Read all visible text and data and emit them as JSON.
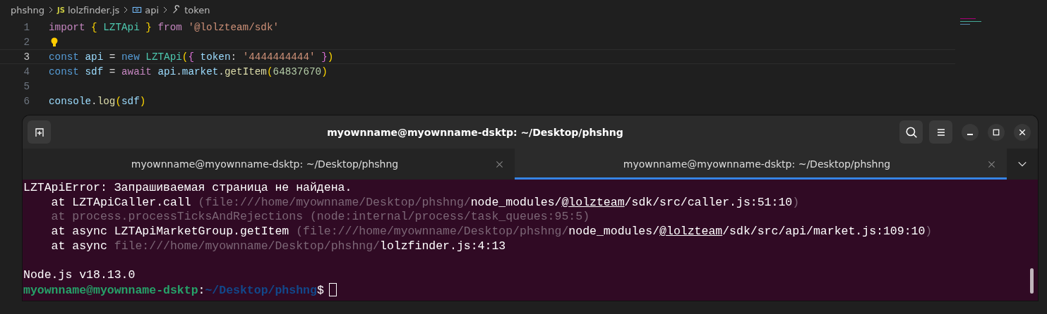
{
  "breadcrumbs": [
    {
      "kind": "folder",
      "label": "phshng"
    },
    {
      "kind": "file",
      "badge": "JS",
      "label": "lolzfinder.js"
    },
    {
      "kind": "variable",
      "label": "api"
    },
    {
      "kind": "property",
      "label": "token"
    }
  ],
  "editor": {
    "lines": [
      {
        "number": "1",
        "current": false,
        "tokens": [
          {
            "kind": "keyword",
            "text": "import "
          },
          {
            "kind": "brace",
            "text": "{ "
          },
          {
            "kind": "type",
            "text": "LZTApi "
          },
          {
            "kind": "brace",
            "text": "} "
          },
          {
            "kind": "keyword",
            "text": "from "
          },
          {
            "kind": "string",
            "text": "'@lolzteam/sdk'"
          }
        ]
      },
      {
        "number": "2",
        "current": false,
        "lightbulb": true
      },
      {
        "number": "3",
        "current": true,
        "tokens": [
          {
            "kind": "storage",
            "text": "const "
          },
          {
            "kind": "variable",
            "text": "api "
          },
          {
            "kind": "plain",
            "text": "= "
          },
          {
            "kind": "storage",
            "text": "new "
          },
          {
            "kind": "type",
            "text": "LZTApi"
          },
          {
            "kind": "brace",
            "text": "("
          },
          {
            "kind": "paren",
            "text": "{ "
          },
          {
            "kind": "variable",
            "text": "token"
          },
          {
            "kind": "plain",
            "text": ": "
          },
          {
            "kind": "string",
            "text": "'4444444444' "
          },
          {
            "kind": "paren",
            "text": "}"
          },
          {
            "kind": "brace",
            "text": ")"
          }
        ]
      },
      {
        "number": "4",
        "current": false,
        "tokens": [
          {
            "kind": "storage",
            "text": "const "
          },
          {
            "kind": "variable",
            "text": "sdf "
          },
          {
            "kind": "plain",
            "text": "= "
          },
          {
            "kind": "keyword",
            "text": "await "
          },
          {
            "kind": "variable",
            "text": "api"
          },
          {
            "kind": "plain",
            "text": "."
          },
          {
            "kind": "variable",
            "text": "market"
          },
          {
            "kind": "plain",
            "text": "."
          },
          {
            "kind": "function",
            "text": "getItem"
          },
          {
            "kind": "brace",
            "text": "("
          },
          {
            "kind": "number",
            "text": "64837670"
          },
          {
            "kind": "brace",
            "text": ")"
          }
        ]
      },
      {
        "number": "5",
        "current": false
      },
      {
        "number": "6",
        "current": false,
        "tokens": [
          {
            "kind": "variable",
            "text": "console"
          },
          {
            "kind": "plain",
            "text": "."
          },
          {
            "kind": "function",
            "text": "log"
          },
          {
            "kind": "brace",
            "text": "("
          },
          {
            "kind": "variable",
            "text": "sdf"
          },
          {
            "kind": "brace",
            "text": ")"
          }
        ]
      }
    ]
  },
  "terminal": {
    "title": "myownname@myownname-dsktp: ~/Desktop/phshng",
    "tabs": [
      {
        "label": "myownname@myownname-dsktp: ~/Desktop/phshng",
        "selected": false
      },
      {
        "label": "myownname@myownname-dsktp: ~/Desktop/phshng",
        "selected": true
      }
    ],
    "output": [
      [
        {
          "kind": "plain",
          "text": "LZTApiError: Запрашиваемая страница не найдена."
        }
      ],
      [
        {
          "kind": "plain",
          "text": "    at LZTApiCaller.call "
        },
        {
          "kind": "dim",
          "text": "(file:///home/myownname/Desktop/phshng/"
        },
        {
          "kind": "plain",
          "text": "node_modules/"
        },
        {
          "kind": "link",
          "text": "@lolzteam"
        },
        {
          "kind": "plain",
          "text": "/sdk/src/caller.js:51:10"
        },
        {
          "kind": "dim",
          "text": ")"
        }
      ],
      [
        {
          "kind": "dim",
          "text": "    at process.processTicksAndRejections (node:internal/process/task_queues:95:5)"
        }
      ],
      [
        {
          "kind": "plain",
          "text": "    at async LZTApiMarketGroup.getItem "
        },
        {
          "kind": "dim",
          "text": "(file:///home/myownname/Desktop/phshng/"
        },
        {
          "kind": "plain",
          "text": "node_modules/"
        },
        {
          "kind": "link",
          "text": "@lolzteam"
        },
        {
          "kind": "plain",
          "text": "/sdk/src/api/market.js:109:10"
        },
        {
          "kind": "dim",
          "text": ")"
        }
      ],
      [
        {
          "kind": "plain",
          "text": "    at async "
        },
        {
          "kind": "dim",
          "text": "file:///home/myownname/Desktop/phshng/"
        },
        {
          "kind": "plain",
          "text": "lolzfinder.js:4:13"
        }
      ],
      [
        {
          "kind": "gap"
        },
        {
          "kind": "plain",
          "text": "Node.js v18.13.0"
        }
      ]
    ],
    "prompt": {
      "user": "myownname@myownname-dsktp",
      "separator": ":",
      "path": "~/Desktop/phshng",
      "symbol": "$"
    }
  }
}
